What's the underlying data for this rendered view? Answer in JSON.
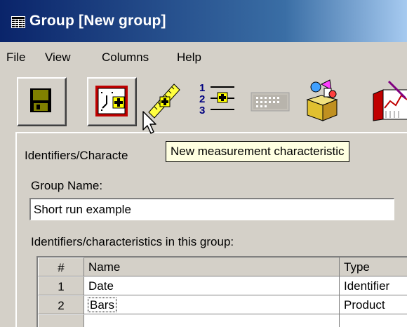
{
  "window": {
    "title": "Group [New group]"
  },
  "menu": {
    "items": [
      "File",
      "View",
      "Columns",
      "Help"
    ]
  },
  "toolbar": {
    "buttons": [
      {
        "icon": "floppy-disk-icon",
        "state": "raised"
      },
      {
        "icon": "new-time-identifier-icon",
        "state": "raised"
      },
      {
        "icon": "new-measurement-characteristic-icon",
        "state": "hover"
      },
      {
        "icon": "numbered-list-add-icon",
        "state": "flat"
      },
      {
        "icon": "disabled-grid-icon",
        "state": "disabled"
      },
      {
        "icon": "package-icon",
        "state": "flat"
      },
      {
        "icon": "chart-edit-icon",
        "state": "flat"
      }
    ],
    "tooltip": "New measurement characteristic"
  },
  "tab": {
    "label": "Identifiers/Characte"
  },
  "form": {
    "group_name_label": "Group Name:",
    "group_name_value": "Short run example",
    "list_label": "Identifiers/characteristics in this group:"
  },
  "table": {
    "headers": {
      "num": "#",
      "name": "Name",
      "type": "Type"
    },
    "rows": [
      {
        "num": "1",
        "name": "Date",
        "type": "Identifier"
      },
      {
        "num": "2",
        "name": "Bars",
        "type": "Product"
      }
    ]
  },
  "colors": {
    "title_gradient_start": "#0a246a",
    "title_gradient_end": "#a6caf0",
    "face": "#d4d0c8",
    "tooltip_bg": "#ffffe1"
  }
}
